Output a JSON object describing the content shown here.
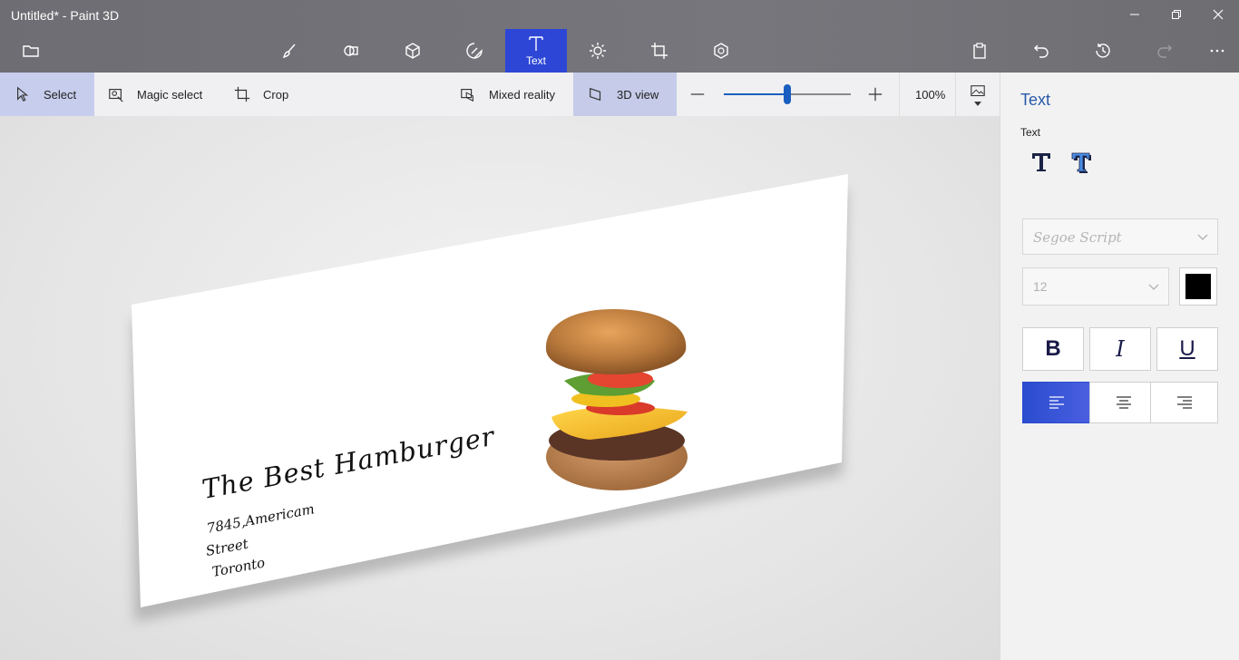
{
  "window": {
    "title": "Untitled* - Paint 3D"
  },
  "main_toolbar": {
    "active_tool_label": "Text"
  },
  "subtoolbar": {
    "select": "Select",
    "magic_select": "Magic select",
    "crop": "Crop",
    "mixed_reality": "Mixed reality",
    "view_3d": "3D view",
    "zoom_percent": "100%",
    "zoom_level": 0.5
  },
  "canvas": {
    "heading": "The Best Hamburger",
    "address_line1": "7845,Americam",
    "address_line2": "Street",
    "address_line3": "Toronto"
  },
  "text_panel": {
    "title": "Text",
    "section_label": "Text",
    "font": "Segoe Script",
    "size": "12",
    "color": "#000000",
    "bold_label": "B",
    "italic_label": "I",
    "underline_label": "U",
    "alignment": "left"
  },
  "colors": {
    "accent": "#2d46d6",
    "titlebar": "#707076"
  }
}
